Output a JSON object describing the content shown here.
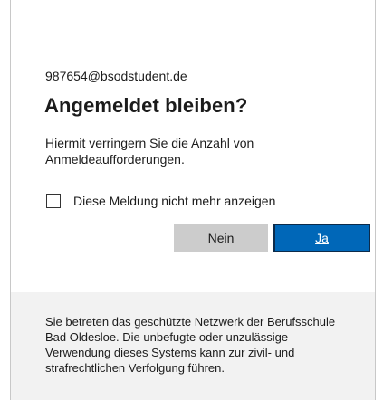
{
  "account": {
    "email": "987654@bsodstudent.de"
  },
  "dialog": {
    "title": "Angemeldet bleiben?",
    "description": "Hiermit verringern Sie die Anzahl von Anmeldeaufforderungen.",
    "checkbox_label": "Diese Meldung nicht mehr anzeigen",
    "checkbox_checked": false
  },
  "buttons": {
    "no_label": "Nein",
    "yes_label": "Ja"
  },
  "footer": {
    "notice": "Sie betreten das geschützte Netzwerk der Berufsschule Bad Oldesloe. Die unbefugte oder unzulässige Verwendung dieses Systems kann zur zivil- und strafrechtlichen Verfolgung führen."
  },
  "colors": {
    "primary": "#0067b8",
    "secondary_button": "#cccccc",
    "footer_background": "#f2f2f2",
    "text": "#1b1b1b"
  }
}
